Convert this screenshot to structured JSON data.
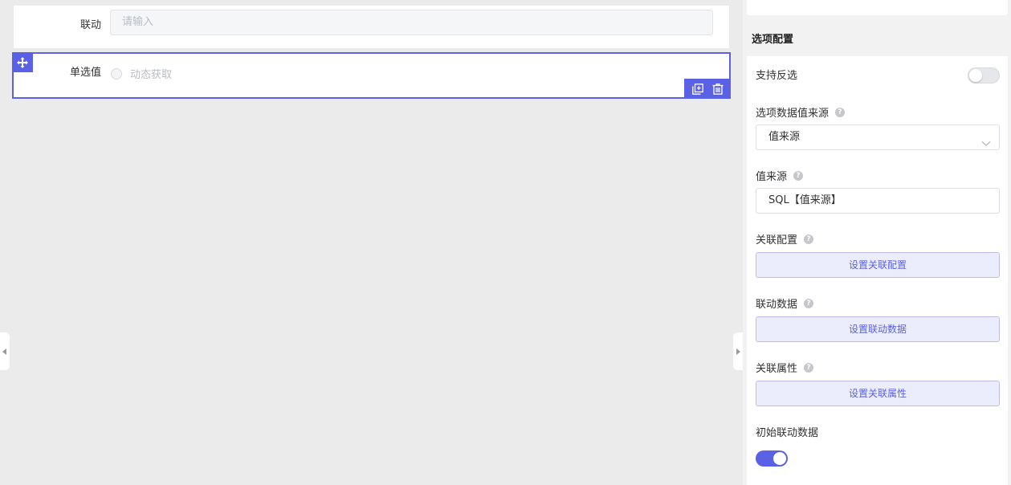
{
  "canvas": {
    "linkage_field": {
      "label": "联动",
      "placeholder": "请输入"
    },
    "radio_field": {
      "label": "单选值",
      "option_label": "动态获取"
    }
  },
  "panel": {
    "section_title": "选项配置",
    "support_inverse": {
      "label": "支持反选",
      "enabled": false
    },
    "option_source": {
      "label": "选项数据值来源",
      "value": "值来源"
    },
    "value_source": {
      "label": "值来源",
      "value": "SQL【值来源】"
    },
    "relation_config": {
      "label": "关联配置",
      "button": "设置关联配置"
    },
    "linkage_data": {
      "label": "联动数据",
      "button": "设置联动数据"
    },
    "relation_attr": {
      "label": "关联属性",
      "button": "设置关联属性"
    },
    "initial_linkage": {
      "label": "初始联动数据",
      "enabled": true
    }
  },
  "colors": {
    "accent": "#5b61e4",
    "button_bg": "#ecedfc"
  },
  "icons": [
    "move-icon",
    "copy-icon",
    "delete-icon",
    "help-icon",
    "chevron-down-icon",
    "collapse-left-icon",
    "collapse-right-icon"
  ]
}
